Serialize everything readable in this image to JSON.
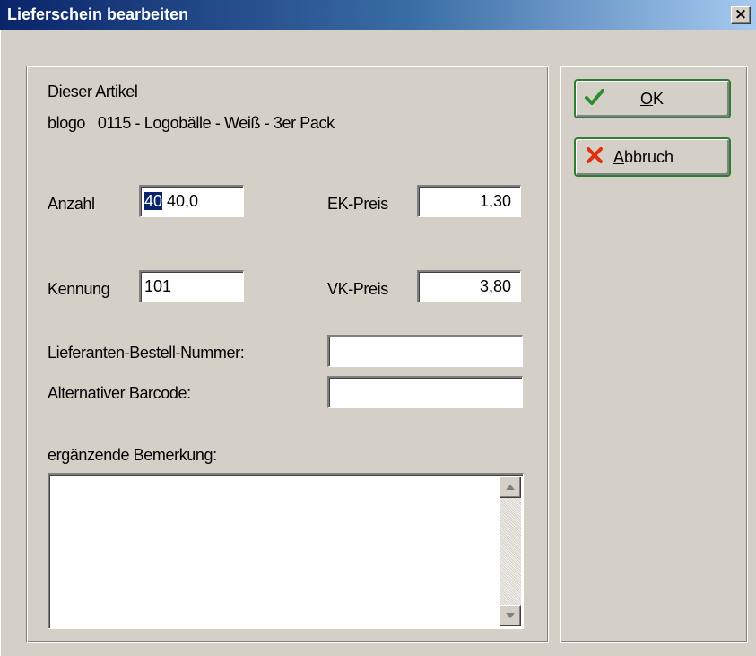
{
  "window": {
    "title": "Lieferschein bearbeiten",
    "close_glyph": "×"
  },
  "article": {
    "label": "Dieser Artikel",
    "description": "blogo   0115 - Logobälle - Weiß - 3er Pack"
  },
  "fields": {
    "anzahl": {
      "label": "Anzahl",
      "selected_text": "40",
      "value": " 40,0"
    },
    "ek_preis": {
      "label": "EK-Preis",
      "value": "1,30"
    },
    "kennung": {
      "label": "Kennung",
      "value": "101"
    },
    "vk_preis": {
      "label": "VK-Preis",
      "value": "3,80"
    },
    "lieferanten_bestell_nummer": {
      "label": "Lieferanten-Bestell-Nummer:",
      "value": ""
    },
    "alternativer_barcode": {
      "label": "Alternativer Barcode:",
      "value": ""
    },
    "bemerkung": {
      "label": "ergänzende Bemerkung:",
      "value": ""
    }
  },
  "buttons": {
    "ok": {
      "mnemonic": "O",
      "rest": "K",
      "icon": "checkmark-icon"
    },
    "abbruch": {
      "mnemonic": "A",
      "rest": "bbruch",
      "icon": "cross-icon"
    }
  },
  "colors": {
    "title_start": "#0a246a",
    "title_end": "#a6caf0",
    "dialog_bg": "#d4d0c8",
    "button_border": "#2e7d32",
    "ok_check": "#2e8b2e",
    "cancel_cross": "#e03010"
  }
}
